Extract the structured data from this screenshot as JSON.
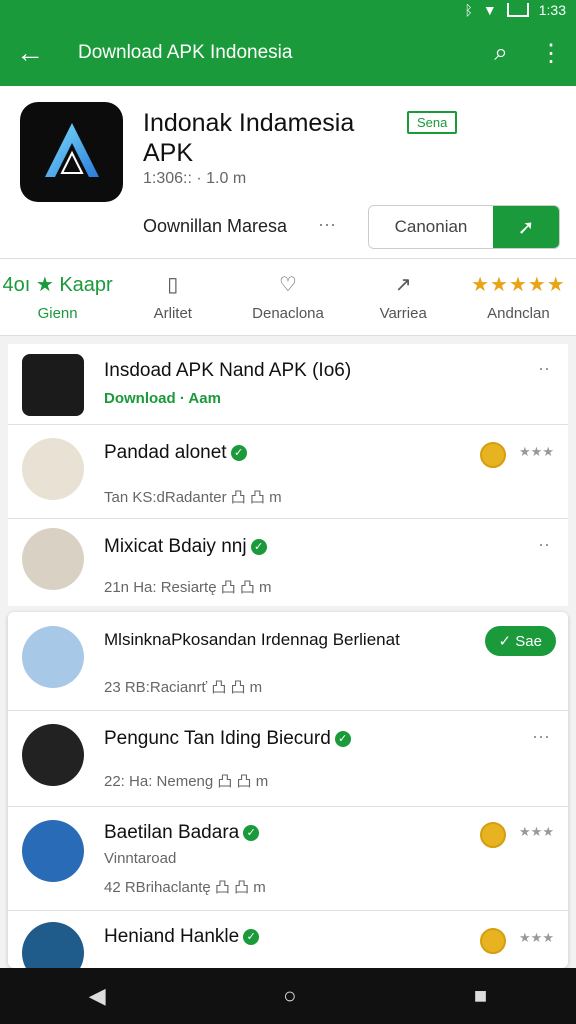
{
  "status": {
    "time": "1:33"
  },
  "appbar": {
    "title": "Download APK Indonesia",
    "back_icon": "arrow-left-icon",
    "search_icon": "search-icon",
    "menu_icon": "more-vert-icon"
  },
  "app": {
    "name": "Indonak Indamesia APK",
    "badge": "Sena",
    "meta": "1:306:: · 1.0 m",
    "download_label": "Oownillan Maresa",
    "more": "···",
    "cancel_label": "Canonian",
    "accent": "#1a9a3a"
  },
  "tabs": [
    {
      "icon": "4oı ★ Kaapr",
      "label": "Gienn"
    },
    {
      "icon": "▯",
      "label": "Arlitet"
    },
    {
      "icon": "♡",
      "label": "Denaclona"
    },
    {
      "icon": "↗",
      "label": "Varriea"
    },
    {
      "icon": "★★★★★",
      "label": "Andnclan"
    }
  ],
  "rows": [
    {
      "name": "Insdoad APK  Nand APK  (Io6)",
      "sub": "Download · Aam"
    },
    {
      "name": "Pandad alonet",
      "sub": "Tan KS:dRadanter 凸 凸 m"
    },
    {
      "name": "Mixicat Bdaiy nnj",
      "sub": "21n Ha: Resiartę 凸 凸 m"
    },
    {
      "name": "MlsinknaPkosandan Irdennag Berlienat",
      "sub": "23 RB:Racianrť 凸 凸 m",
      "pill": "Sae"
    },
    {
      "name": "Pengunc Tan Iding Biecurd",
      "sub": "22: Ha: Nemeng 凸 凸 m"
    },
    {
      "name": "Baetilan Badara",
      "sub2": "Vinntaroad",
      "sub": "42 RBrihaclantę 凸 凸 m"
    },
    {
      "name": "Heniand Hankle",
      "sub": ""
    }
  ],
  "rating_stars": "★★★",
  "nav": {
    "back": "◀",
    "home": "○",
    "recents": "■"
  }
}
